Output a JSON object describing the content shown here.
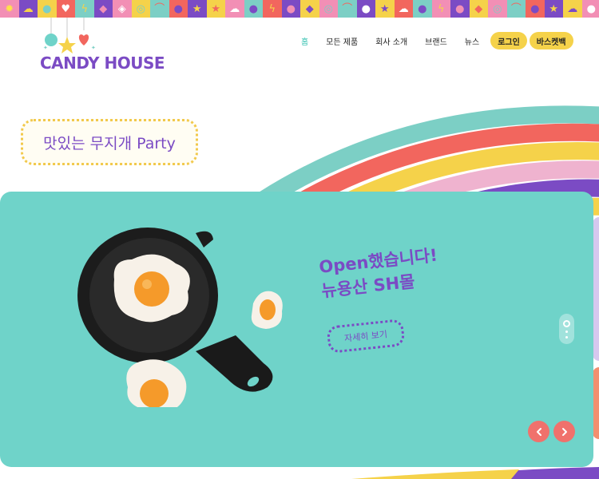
{
  "brand": {
    "name": "CANDY HOUSE"
  },
  "nav": {
    "items": [
      {
        "label": "홈",
        "active": true
      },
      {
        "label": "모든 제품",
        "active": false
      },
      {
        "label": "회사 소개",
        "active": false
      },
      {
        "label": "브랜드",
        "active": false
      },
      {
        "label": "뉴스",
        "active": false
      }
    ],
    "login_label": "로그인",
    "cart_label": "바스켓백"
  },
  "tagline": "맛있는 무지개 Party",
  "slide": {
    "headline_line1": "Open했습니다!",
    "headline_line2": "뉴용산 SH몰",
    "cta_label": "자세히 보기"
  },
  "colors": {
    "accent_purple": "#7b4bc4",
    "teal": "#6fd3c9",
    "yellow": "#f5d24a",
    "coral": "#f0716c",
    "active_nav": "#2fbfae"
  },
  "icons": {
    "prev": "chevron-left-icon",
    "next": "chevron-right-icon"
  }
}
